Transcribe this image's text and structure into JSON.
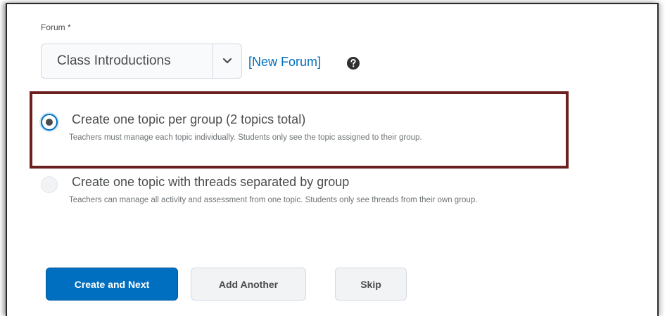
{
  "forum": {
    "label": "Forum *",
    "selected_value": "Class Introductions",
    "new_forum_link": "[New Forum]",
    "help_icon": "question-circle-icon"
  },
  "options": [
    {
      "title": "Create one topic per group (2 topics total)",
      "description": "Teachers must manage each topic individually. Students only see the topic assigned to their group.",
      "checked": true
    },
    {
      "title": "Create one topic with threads separated by group",
      "description": "Teachers can manage all activity and assessment from one topic. Students only see threads from their own group.",
      "checked": false
    }
  ],
  "buttons": {
    "create_next": "Create and Next",
    "add_another": "Add Another",
    "skip": "Skip"
  },
  "colors": {
    "primary": "#006fbf",
    "highlight_border": "#6b1f1f",
    "text": "#494c4e",
    "muted_text": "#6e7376"
  }
}
